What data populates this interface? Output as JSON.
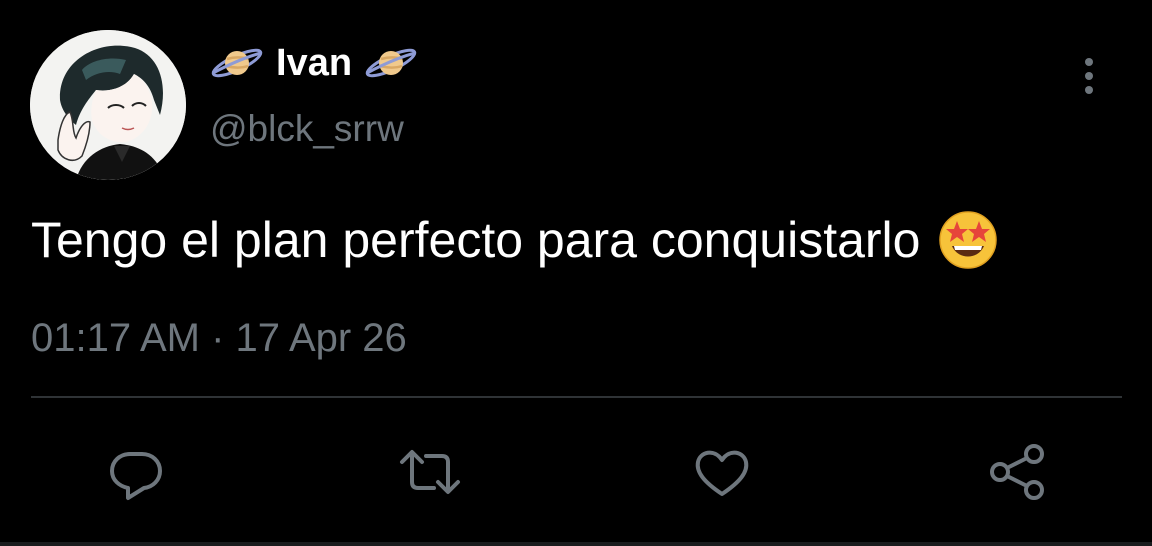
{
  "tweet": {
    "display_name": "Ivan",
    "name_decoration_icon": "ringed-planet-emoji",
    "handle": "@blck_srrw",
    "text": "Tengo el plan perfecto para conquistarlo",
    "text_emoji": "star-struck-emoji",
    "timestamp": "01:17 AM · 17 Apr 26",
    "avatar_description": "avatar-image",
    "more_icon": "more-vertical-icon"
  },
  "actions": [
    {
      "icon": "reply-icon"
    },
    {
      "icon": "retweet-icon"
    },
    {
      "icon": "like-icon"
    },
    {
      "icon": "share-icon"
    }
  ],
  "colors": {
    "background": "#000000",
    "text_primary": "#ffffff",
    "text_secondary": "#6e767d",
    "divider": "#2f3336",
    "icon": "#6e767d"
  }
}
